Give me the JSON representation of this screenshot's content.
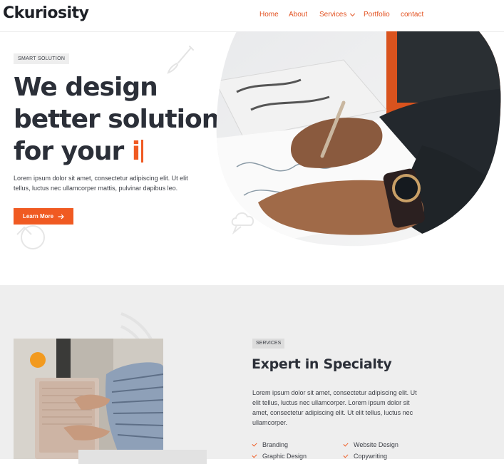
{
  "header": {
    "logo": "Ckuriosity",
    "nav": {
      "home": "Home",
      "about": "About",
      "services": "Services",
      "portfolio": "Portfolio",
      "contact": "contact"
    }
  },
  "hero": {
    "badge": "SMART SOLUTION",
    "title_line1": "We design",
    "title_line2": "better solution",
    "title_line3_prefix": "for your ",
    "title_typed": "i",
    "description": "Lorem ipsum dolor sit amet, consectetur adipiscing elit. Ut elit tellus, luctus nec ullamcorper mattis, pulvinar dapibus leo.",
    "button_label": "Learn More",
    "button_icon": "arrow-right-icon"
  },
  "services": {
    "badge": "SERVICES",
    "title": "Expert in Specialty",
    "description": "Lorem ipsum dolor sit amet, consectetur adipiscing elit. Ut elit tellus, luctus nec ullamcorper. Lorem ipsum dolor sit amet, consectetur adipiscing elit. Ut elit tellus, luctus nec ullamcorper.",
    "items": [
      "Branding",
      "Website Design",
      "Graphic Design",
      "Copywriting"
    ]
  },
  "colors": {
    "accent": "#f05a22",
    "nav_text": "#e2501f",
    "section_bg": "#eeeeee",
    "heading": "#2b2f38"
  }
}
